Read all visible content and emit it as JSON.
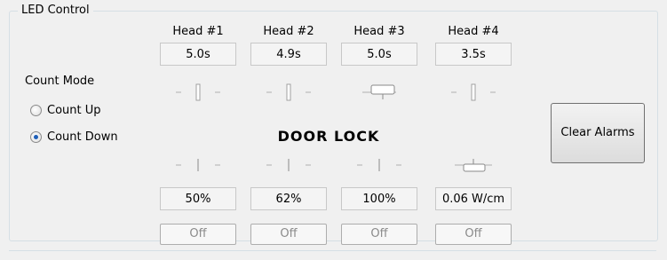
{
  "group": {
    "title": "LED Control"
  },
  "heads": [
    {
      "label": "Head #1",
      "time": "5.0s",
      "level": "50%",
      "status": "Off"
    },
    {
      "label": "Head #2",
      "time": "4.9s",
      "level": "62%",
      "status": "Off"
    },
    {
      "label": "Head #3",
      "time": "5.0s",
      "level": "100%",
      "status": "Off"
    },
    {
      "label": "Head #4",
      "time": "3.5s",
      "level": "0.06 W/cm",
      "status": "Off"
    }
  ],
  "count_mode": {
    "label": "Count Mode",
    "options": [
      {
        "label": "Count Up",
        "checked": false
      },
      {
        "label": "Count Down",
        "checked": true
      }
    ]
  },
  "door_lock": "DOOR LOCK",
  "clear_button": "Clear Alarms"
}
